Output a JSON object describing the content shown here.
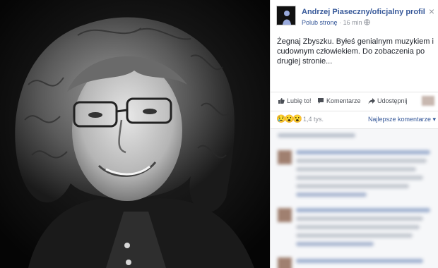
{
  "post": {
    "page_name": "Andrzej Piaseczny/oficjalny profil",
    "like_page": "Polub stronę",
    "separator": "·",
    "time": "16 min",
    "close": "×",
    "text": "Żegnaj Zbyszku. Byłeś genialnym muzykiem i cudownym człowiekiem. Do zobaczenia po drugiej stronie..."
  },
  "actions": {
    "like": "Lubię to!",
    "comment": "Komentarze",
    "share": "Udostępnij"
  },
  "reactions": {
    "emojis": "😢😮😮",
    "count": "1,4 tys.",
    "sort_label": "Najlepsze komentarze ▾"
  },
  "icons": [
    "globe-icon",
    "like-icon",
    "comment-icon",
    "share-icon",
    "sad-emoji-icon",
    "wow-emoji-icon",
    "close-icon"
  ],
  "colors": {
    "link": "#365899",
    "text": "#1d2129",
    "muted": "#90949c",
    "photo_bg": "#0b0b0b",
    "comments_bg": "#f6f7f9"
  }
}
